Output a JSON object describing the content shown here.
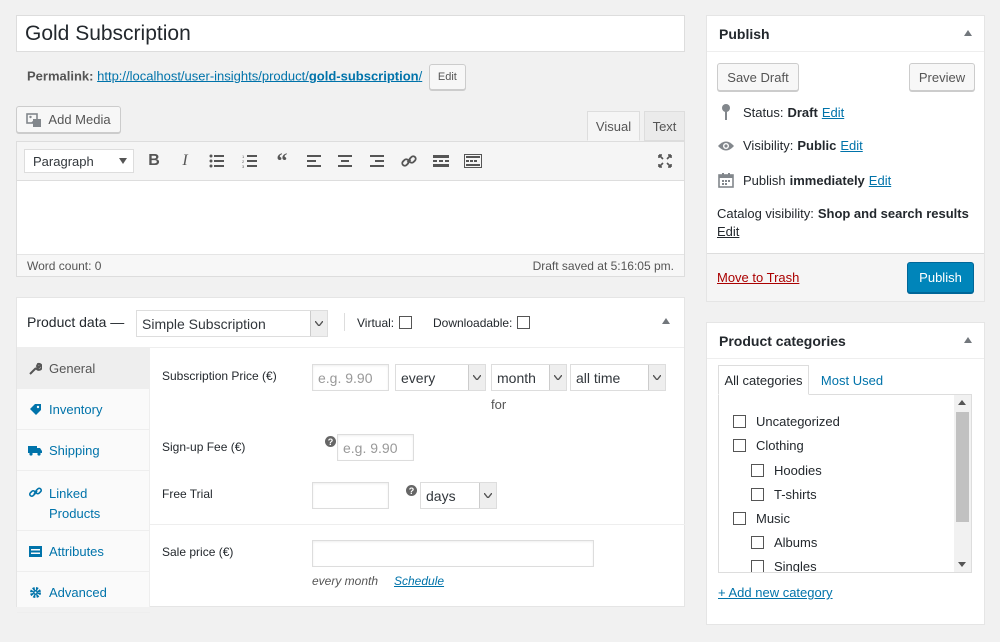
{
  "post": {
    "title": "Gold Subscription",
    "permalink_label": "Permalink:",
    "permalink_base": "http://localhost/user-insights/product/",
    "permalink_slug": "gold-subscription",
    "permalink_trailing": "/",
    "edit_label": "Edit"
  },
  "editor": {
    "add_media": "Add Media",
    "tab_visual": "Visual",
    "tab_text": "Text",
    "format_select": "Paragraph",
    "word_count": "Word count: 0",
    "draft_saved": "Draft saved at 5:16:05 pm."
  },
  "product_data": {
    "title": "Product data —",
    "type": "Simple Subscription",
    "virtual_label": "Virtual:",
    "downloadable_label": "Downloadable:",
    "nav": [
      {
        "label": "General",
        "icon": "wrench-icon"
      },
      {
        "label": "Inventory",
        "icon": "tag-icon"
      },
      {
        "label": "Shipping",
        "icon": "truck-icon"
      },
      {
        "label": "Linked Products",
        "icon": "link-icon"
      },
      {
        "label": "Attributes",
        "icon": "list-icon"
      },
      {
        "label": "Advanced",
        "icon": "gear-icon"
      }
    ],
    "subscription_price_label": "Subscription Price (€)",
    "price_placeholder": "e.g. 9.90",
    "interval": "every",
    "period": "month",
    "length": "all time",
    "for_label": "for",
    "signup_fee_label": "Sign-up Fee (€)",
    "signup_placeholder": "e.g. 9.90",
    "free_trial_label": "Free Trial",
    "trial_period": "days",
    "sale_price_label": "Sale price (€)",
    "sale_note": "every month",
    "schedule_link": "Schedule"
  },
  "publish": {
    "title": "Publish",
    "save_draft": "Save Draft",
    "preview": "Preview",
    "status_label": "Status:",
    "status_value": "Draft",
    "visibility_label": "Visibility:",
    "visibility_value": "Public",
    "publish_label": "Publish",
    "publish_value": "immediately",
    "catalog_label": "Catalog visibility:",
    "catalog_value": "Shop and search results",
    "edit": "Edit",
    "trash": "Move to Trash",
    "publish_button": "Publish"
  },
  "categories": {
    "title": "Product categories",
    "tab_all": "All categories",
    "tab_most_used": "Most Used",
    "items": [
      {
        "label": "Uncategorized",
        "level": 0
      },
      {
        "label": "Clothing",
        "level": 0
      },
      {
        "label": "Hoodies",
        "level": 1
      },
      {
        "label": "T-shirts",
        "level": 1
      },
      {
        "label": "Music",
        "level": 0
      },
      {
        "label": "Albums",
        "level": 1
      },
      {
        "label": "Singles",
        "level": 1
      }
    ],
    "add_new": "+ Add new category"
  },
  "colors": {
    "link": "#0073aa",
    "primary_button": "#0085ba",
    "trash": "#a00"
  }
}
